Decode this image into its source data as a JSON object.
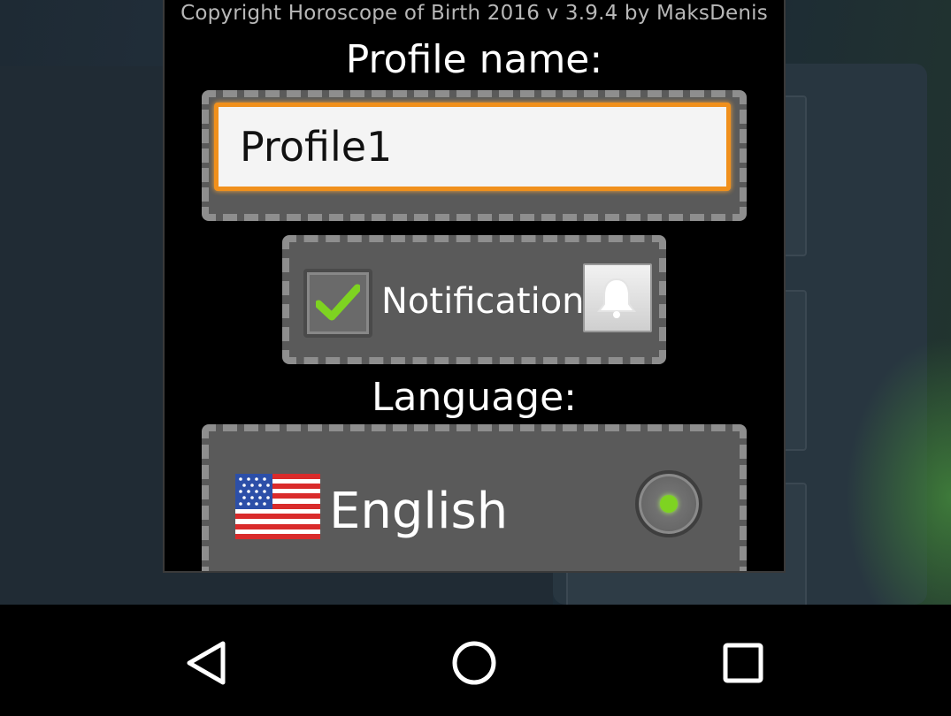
{
  "dialog": {
    "copyright": "Copyright Horoscope of Birth 2016 v 3.9.4 by MaksDenis",
    "profile_label": "Profile name:",
    "profile_value": "Profile1",
    "notification_label": "Notification",
    "notification_checked": true,
    "language_label": "Language:",
    "language_option": "English",
    "language_selected": true
  },
  "icons": {
    "checkbox": "check-icon",
    "bell": "bell-icon",
    "flag": "us-flag-icon",
    "back": "back-icon",
    "home": "home-icon",
    "recent": "recent-apps-icon"
  },
  "colors": {
    "input_border": "#f0901c",
    "check": "#7ed321",
    "radio_dot": "#7ed321"
  }
}
